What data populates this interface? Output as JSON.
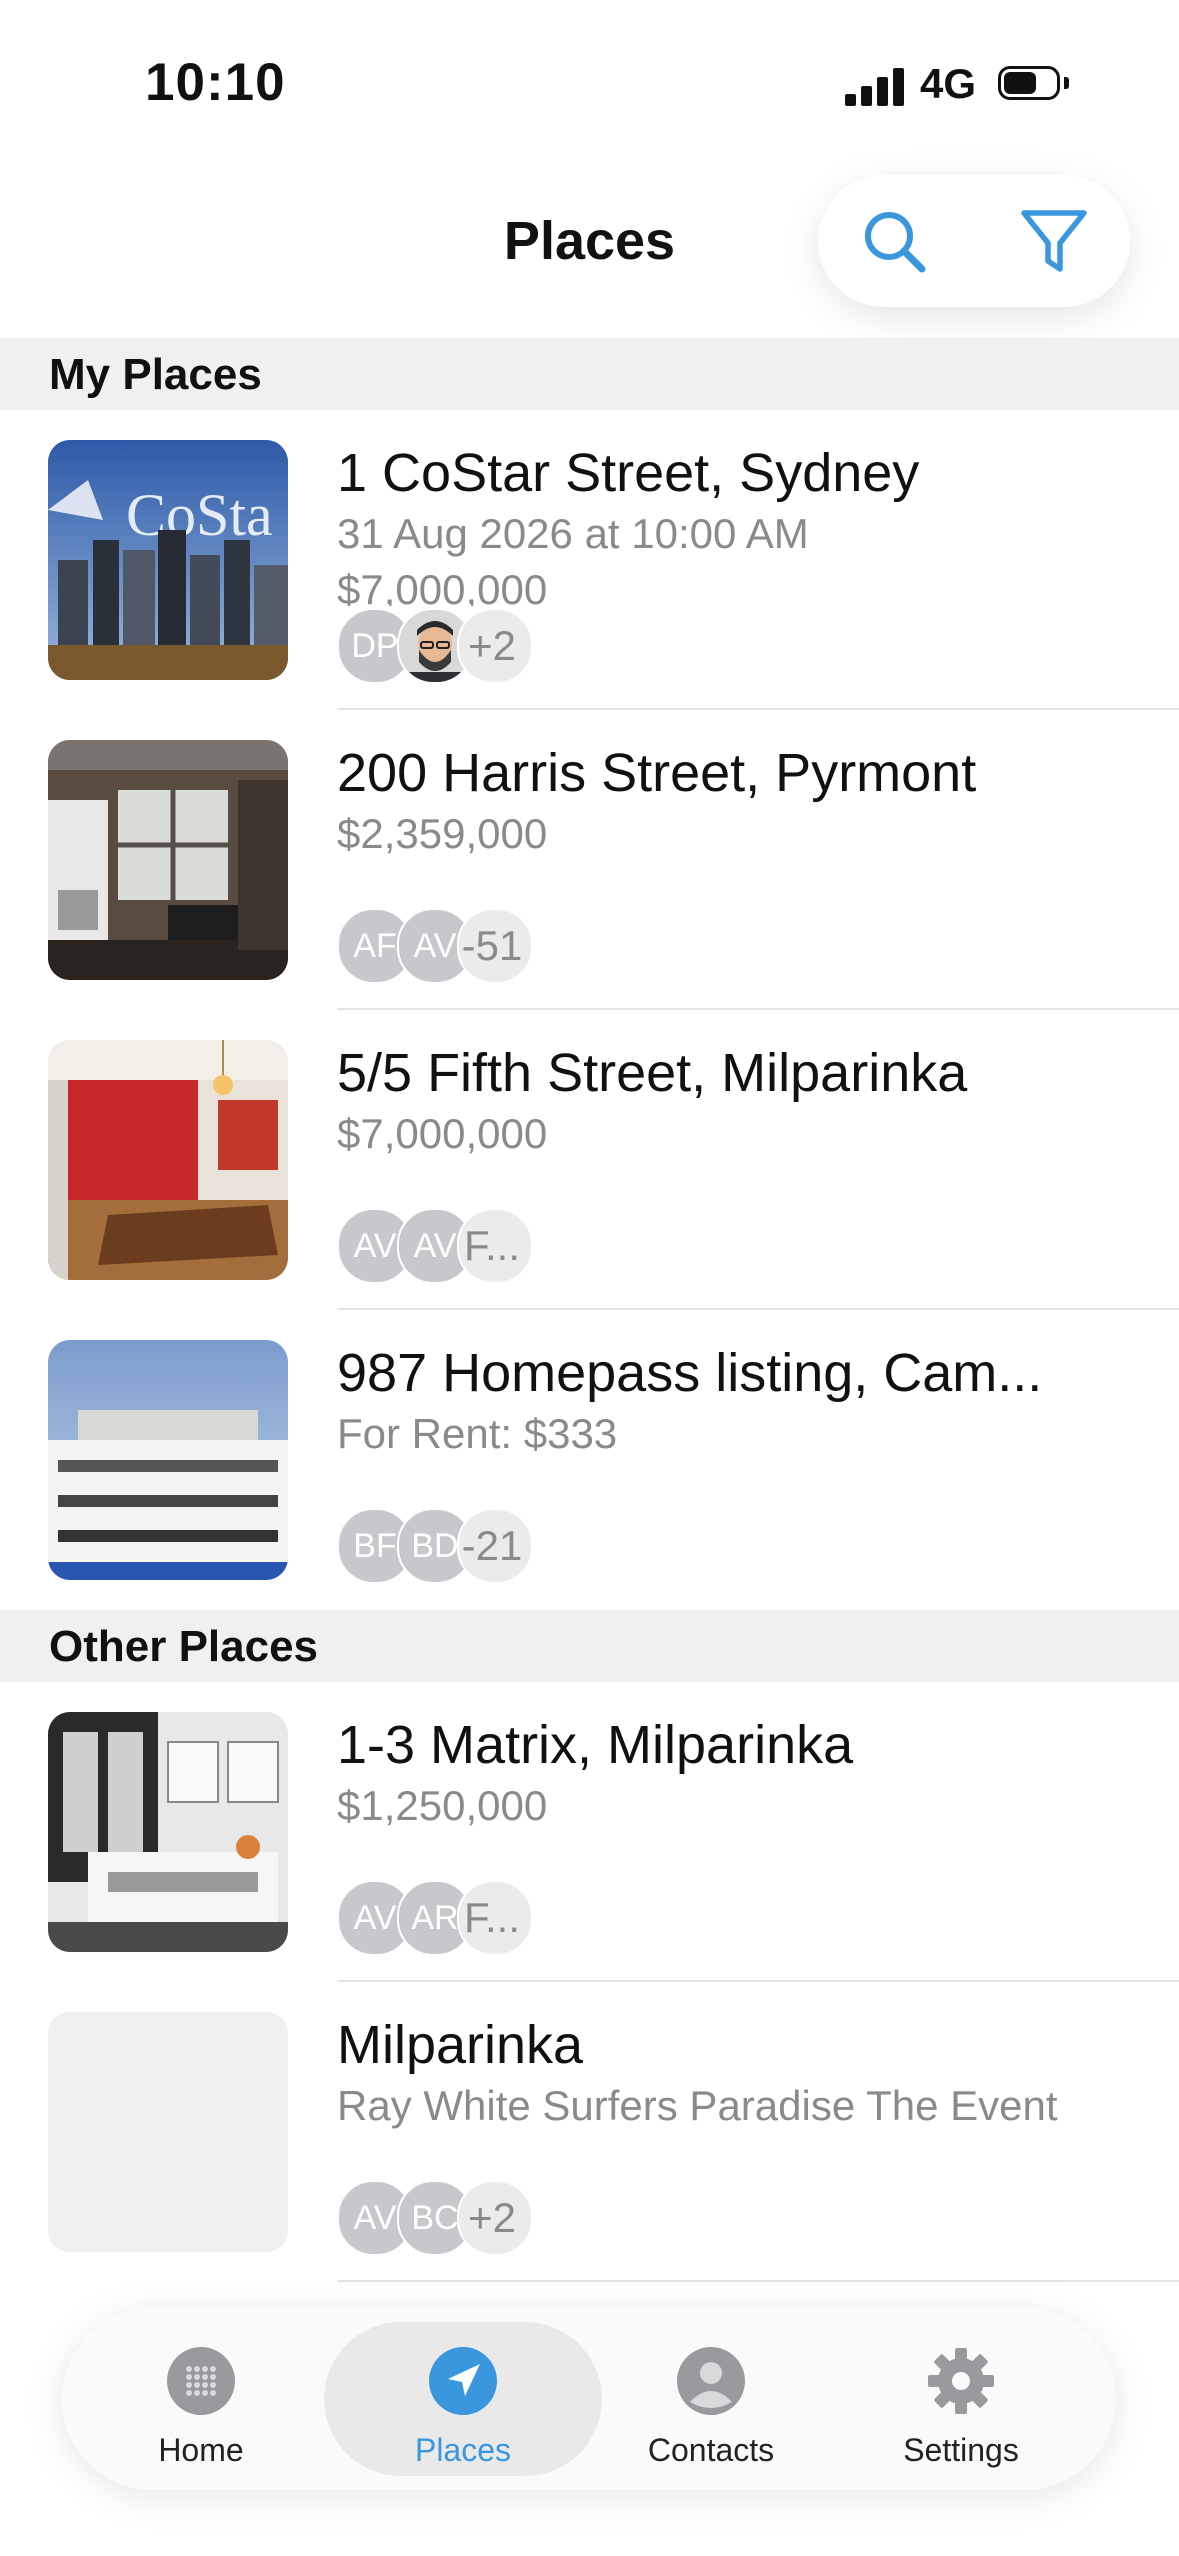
{
  "status": {
    "time": "10:10",
    "network": "4G"
  },
  "header": {
    "title": "Places"
  },
  "sections": {
    "my_places": "My Places",
    "other_places": "Other Places"
  },
  "places": [
    {
      "title": "1 CoStar Street, Sydney",
      "sub": "31 Aug 2026 at 10:00 AM",
      "sub2": "$7,000,000",
      "avatars": [
        "DP",
        "",
        "+2"
      ]
    },
    {
      "title": "200 Harris Street, Pyrmont",
      "sub": "$2,359,000",
      "avatars": [
        "AF",
        "AV",
        "-51"
      ]
    },
    {
      "title": "5/5 Fifth Street, Milparinka",
      "sub": "$7,000,000",
      "avatars": [
        "AV",
        "AV",
        "F..."
      ]
    },
    {
      "title": "987 Homepass listing, Cam...",
      "sub": "For Rent: $333",
      "avatars": [
        "BF",
        "BD",
        "-21"
      ]
    },
    {
      "title": "1-3 Matrix, Milparinka",
      "sub": "$1,250,000",
      "avatars": [
        "AV",
        "AR",
        "F..."
      ]
    },
    {
      "title": "Milparinka",
      "sub": "Ray White Surfers Paradise The Event",
      "avatars": [
        "AV",
        "BC",
        "+2"
      ]
    }
  ],
  "tabs": [
    {
      "label": "Home",
      "icon": "home-grid-icon"
    },
    {
      "label": "Places",
      "icon": "location-arrow-icon",
      "active": true
    },
    {
      "label": "Contacts",
      "icon": "person-icon"
    },
    {
      "label": "Settings",
      "icon": "gear-icon"
    }
  ],
  "colors": {
    "accent": "#3a96dd",
    "secondary_text": "#8a8a8e",
    "section_bg": "#f0f0f0"
  }
}
